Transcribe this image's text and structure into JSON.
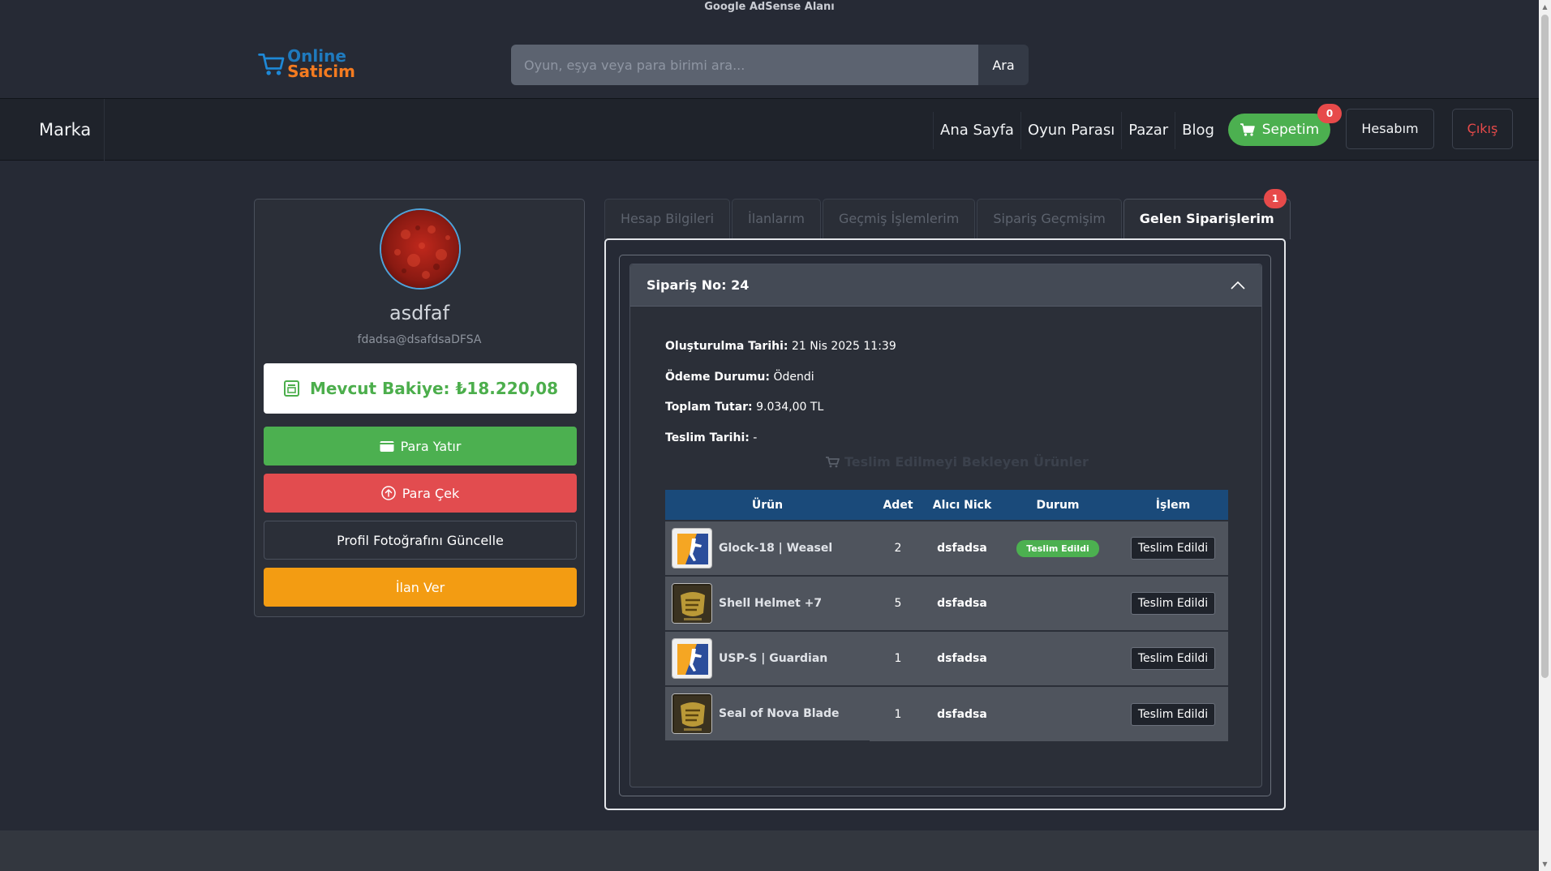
{
  "top": {
    "adsense": "Google AdSense Alanı"
  },
  "logo": {
    "line1": "Online",
    "line2": "Saticim"
  },
  "search": {
    "placeholder": "Oyun, eşya veya para birimi ara...",
    "button": "Ara"
  },
  "navbar": {
    "brand": "Marka",
    "links": [
      "Ana Sayfa",
      "Oyun Parası",
      "Pazar",
      "Blog"
    ],
    "cart_label": "Sepetim",
    "cart_count": "0",
    "account": "Hesabım",
    "logout": "Çıkış"
  },
  "profile": {
    "username": "asdfaf",
    "email": "fdadsa@dsafdsaDFSA",
    "balance": "Mevcut Bakiye: ₺18.220,08",
    "deposit": "Para Yatır",
    "withdraw": "Para Çek",
    "update_photo": "Profil Fotoğrafını Güncelle",
    "post_listing": "İlan Ver"
  },
  "tabs": [
    "Hesap Bilgileri",
    "İlanlarım",
    "Geçmiş İşlemlerim",
    "Sipariş Geçmişim",
    "Gelen Siparişlerim"
  ],
  "tab_badge": "1",
  "order": {
    "title": "Sipariş No: 24",
    "created_label": "Oluşturulma Tarihi:",
    "created_value": "21 Nis 2025 11:39",
    "payment_label": "Ödeme Durumu:",
    "payment_value": "Ödendi",
    "total_label": "Toplam Tutar:",
    "total_value": "9.034,00 TL",
    "delivery_label": "Teslim Tarihi:",
    "delivery_value": "-",
    "pending_heading": "Teslim Edilmeyi Bekleyen Ürünler",
    "columns": [
      "Ürün",
      "Adet",
      "Alıcı Nick",
      "Durum",
      "İşlem"
    ],
    "rows": [
      {
        "product": "Glock-18 | Weasel",
        "qty": "2",
        "nick": "dsfadsa",
        "status": "Teslim Edildi",
        "action": "Teslim Edildi",
        "thumb": "cs-icon"
      },
      {
        "product": "Shell Helmet +7",
        "qty": "5",
        "nick": "dsfadsa",
        "status": "",
        "action": "Teslim Edildi",
        "thumb": "game-logo-icon"
      },
      {
        "product": "USP-S | Guardian",
        "qty": "1",
        "nick": "dsfadsa",
        "status": "",
        "action": "Teslim Edildi",
        "thumb": "cs-icon"
      },
      {
        "product": "Seal of Nova Blade",
        "qty": "1",
        "nick": "dsfadsa",
        "status": "",
        "action": "Teslim Edildi",
        "thumb": "game-logo-icon"
      }
    ]
  },
  "colors": {
    "green": "#4cb050",
    "red": "#e24c4f",
    "orange": "#f39c12",
    "table_head": "#1a4a7a"
  }
}
